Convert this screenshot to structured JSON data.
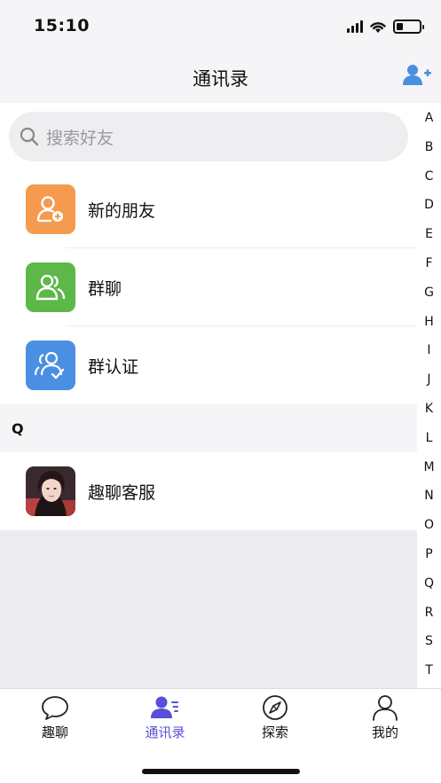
{
  "status_bar": {
    "time": "15:10"
  },
  "nav": {
    "title": "通讯录",
    "add_icon": "add-user-icon"
  },
  "search": {
    "placeholder": "搜索好友"
  },
  "menu_items": [
    {
      "label": "新的朋友",
      "icon": "add-person-icon",
      "color": "#f59a4e"
    },
    {
      "label": "群聊",
      "icon": "group-icon",
      "color": "#5cb848"
    },
    {
      "label": "群认证",
      "icon": "verified-group-icon",
      "color": "#4a8fe2"
    }
  ],
  "sections": [
    {
      "letter": "Q",
      "contacts": [
        {
          "name": "趣聊客服"
        }
      ]
    }
  ],
  "index_letters": [
    "A",
    "B",
    "C",
    "D",
    "E",
    "F",
    "G",
    "H",
    "I",
    "J",
    "K",
    "L",
    "M",
    "N",
    "O",
    "P",
    "Q",
    "R",
    "S",
    "T"
  ],
  "tabs": [
    {
      "label": "趣聊",
      "icon": "chat-bubble-icon",
      "active": false
    },
    {
      "label": "通讯录",
      "icon": "contacts-icon",
      "active": true
    },
    {
      "label": "探索",
      "icon": "compass-icon",
      "active": false
    },
    {
      "label": "我的",
      "icon": "profile-icon",
      "active": false
    }
  ],
  "colors": {
    "accent": "#5a4fd9",
    "add_icon": "#4a8fe2"
  }
}
